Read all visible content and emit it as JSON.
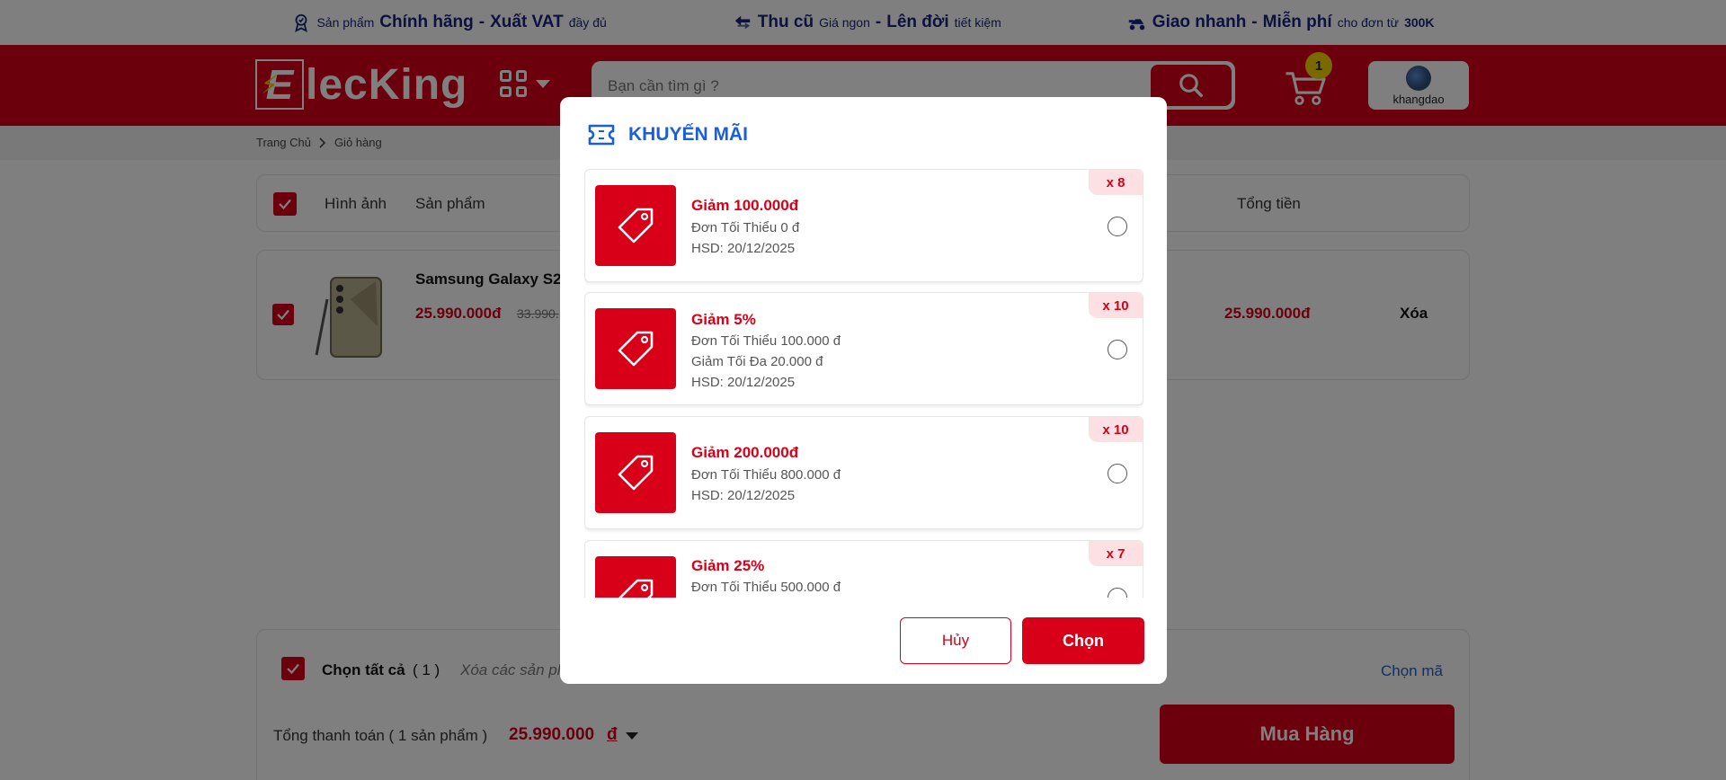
{
  "promo": {
    "p1_small1": "Sản phẩm",
    "p1_big1": "Chính hãng",
    "p1_dash": "-",
    "p1_big2": "Xuất VAT",
    "p1_small2": "đầy đủ",
    "p2_big1": "Thu cũ",
    "p2_small1": "Giá ngon",
    "p2_dash": "-",
    "p2_big2": "Lên đời",
    "p2_small2": "tiết kiệm",
    "p3_big1": "Giao nhanh",
    "p3_dash": "-",
    "p3_big2": "Miễn phí",
    "p3_small1": "cho đơn từ",
    "p3_bold": "300K"
  },
  "header": {
    "logo_letter": "E",
    "logo_name": "lecKing",
    "search_placeholder": "Bạn cần tìm gì ?",
    "cart_count": "1",
    "username": "khangdao"
  },
  "breadcrumb": {
    "home": "Trang Chủ",
    "current": "Giỏ hàng"
  },
  "table": {
    "col_image": "Hình ảnh",
    "col_product": "Sản phẩm",
    "col_total": "Tổng tiền"
  },
  "cart_item": {
    "name": "Samsung Galaxy S2",
    "price": "25.990.000đ",
    "old_price": "33.990.",
    "total": "25.990.000đ",
    "delete": "Xóa"
  },
  "footer": {
    "select_all": "Chọn tất cả",
    "count": "( 1 )",
    "delete_selected": "Xóa các sản ph",
    "choose_code": "Chọn mã",
    "total_label": "Tổng thanh toán ( 1 sản phẩm )",
    "total_value": "25.990.000",
    "currency": "đ",
    "buy_button": "Mua Hàng"
  },
  "modal": {
    "title": "KHUYẾN MÃI",
    "vouchers": [
      {
        "title": "Giảm 100.000đ",
        "min": "Đơn Tối Thiểu 0 đ",
        "max": "",
        "expiry": "HSD: 20/12/2025",
        "qty": "x 8"
      },
      {
        "title": "Giảm 5%",
        "min": "Đơn Tối Thiểu 100.000 đ",
        "max": "Giảm Tối Đa 20.000 đ",
        "expiry": "HSD: 20/12/2025",
        "qty": "x 10"
      },
      {
        "title": "Giảm 200.000đ",
        "min": "Đơn Tối Thiểu 800.000 đ",
        "max": "",
        "expiry": "HSD: 20/12/2025",
        "qty": "x 10"
      },
      {
        "title": "Giảm 25%",
        "min": "Đơn Tối Thiểu 500.000 đ",
        "max": "",
        "expiry": "",
        "qty": "x 7"
      }
    ],
    "cancel_label": "Hủy",
    "select_label": "Chọn"
  },
  "colors": {
    "brand_red": "#d70018",
    "accent_blue": "#1a5fd6",
    "badge_yellow": "#f5d000"
  }
}
